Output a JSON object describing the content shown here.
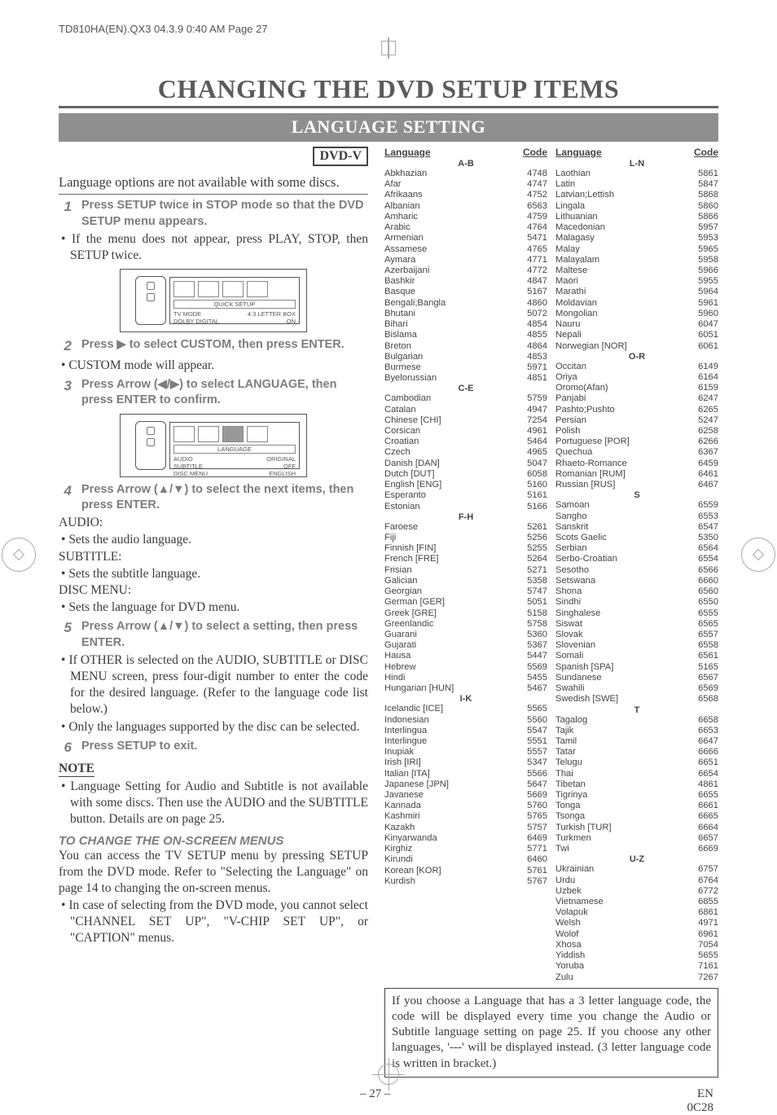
{
  "header": "TD810HA(EN).QX3  04.3.9  0:40 AM  Page 27",
  "title": "CHANGING THE DVD SETUP ITEMS",
  "subtitle": "LANGUAGE SETTING",
  "dvd_badge": "DVD-V",
  "intro": "Language options are not available with some discs.",
  "steps": {
    "s1": {
      "num": "1",
      "text": "Press SETUP twice in STOP mode so that the DVD SETUP menu appears."
    },
    "s1_note": "If the menu does not appear, press PLAY, STOP, then SETUP twice.",
    "diagram1": {
      "bar": "QUICK SETUP",
      "l1a": "TV MODE",
      "l1b": "4:3 LETTER BOX",
      "l2a": "DOLBY DIGITAL",
      "l2b": "ON"
    },
    "s2": {
      "num": "2",
      "text": "Press ▶ to select CUSTOM, then press ENTER."
    },
    "s2_note": "CUSTOM mode will appear.",
    "s3": {
      "num": "3",
      "text": "Press Arrow (◀/▶) to select LANGUAGE, then press ENTER to confirm."
    },
    "diagram2": {
      "bar": "LANGUAGE",
      "l1a": "AUDIO",
      "l1b": "ORIGINAL",
      "l2a": "SUBTITLE",
      "l2b": "OFF",
      "l3a": "DISC MENU",
      "l3b": "ENGLISH"
    },
    "s4": {
      "num": "4",
      "text": "Press Arrow (▲/▼) to select the next items, then press ENTER."
    },
    "audio_label": "AUDIO:",
    "audio_desc": "Sets the audio language.",
    "subtitle_label": "SUBTITLE:",
    "subtitle_desc": "Sets the subtitle language.",
    "disc_label": "DISC MENU:",
    "disc_desc": "Sets the language for DVD menu.",
    "s5": {
      "num": "5",
      "text": "Press Arrow (▲/▼) to select a setting, then press ENTER."
    },
    "s5_n1": "If OTHER is selected on the AUDIO, SUBTITLE or DISC MENU screen, press four-digit number to enter the code for the desired language. (Refer to the language code list below.)",
    "s5_n2": "Only the languages supported by the disc can be selected.",
    "s6": {
      "num": "6",
      "text": "Press SETUP to exit."
    },
    "note_head": "NOTE",
    "note_body": "Language Setting for Audio and Subtitle is not available with some discs. Then use the AUDIO and the SUBTITLE button. Details are on page 25.",
    "menus_head": "TO CHANGE THE ON-SCREEN MENUS",
    "menus_body": "You can access the TV SETUP menu by pressing SETUP from the DVD mode. Refer to \"Selecting the Language\" on page 14 to changing the on-screen menus.",
    "menus_bullet": "In case of selecting from the DVD mode, you cannot select \"CHANNEL SET UP\", \"V-CHIP SET UP\", or \"CAPTION\" menus."
  },
  "table": {
    "h_lang": "Language",
    "h_code": "Code",
    "col1": [
      {
        "type": "section",
        "label": "A-B"
      },
      {
        "name": "Abkhazian",
        "code": "4748"
      },
      {
        "name": "Afar",
        "code": "4747"
      },
      {
        "name": "Afrikaans",
        "code": "4752"
      },
      {
        "name": "Albanian",
        "code": "6563"
      },
      {
        "name": "Amharic",
        "code": "4759"
      },
      {
        "name": "Arabic",
        "code": "4764"
      },
      {
        "name": "Armenian",
        "code": "5471"
      },
      {
        "name": "Assamese",
        "code": "4765"
      },
      {
        "name": "Aymara",
        "code": "4771"
      },
      {
        "name": "Azerbaijani",
        "code": "4772"
      },
      {
        "name": "Bashkir",
        "code": "4847"
      },
      {
        "name": "Basque",
        "code": "5167"
      },
      {
        "name": "Bengali;Bangla",
        "code": "4860"
      },
      {
        "name": "Bhutani",
        "code": "5072"
      },
      {
        "name": "Bihari",
        "code": "4854"
      },
      {
        "name": "Bislama",
        "code": "4855"
      },
      {
        "name": "Breton",
        "code": "4864"
      },
      {
        "name": "Bulgarian",
        "code": "4853"
      },
      {
        "name": "Burmese",
        "code": "5971"
      },
      {
        "name": "Byelorussian",
        "code": "4851"
      },
      {
        "type": "section",
        "label": "C-E"
      },
      {
        "name": "Cambodian",
        "code": "5759"
      },
      {
        "name": "Catalan",
        "code": "4947"
      },
      {
        "name": "Chinese [CHI]",
        "code": "7254"
      },
      {
        "name": "Corsican",
        "code": "4961"
      },
      {
        "name": "Croatian",
        "code": "5464"
      },
      {
        "name": "Czech",
        "code": "4965"
      },
      {
        "name": "Danish [DAN]",
        "code": "5047"
      },
      {
        "name": "Dutch [DUT]",
        "code": "6058"
      },
      {
        "name": "English [ENG]",
        "code": "5160"
      },
      {
        "name": "Esperanto",
        "code": "5161"
      },
      {
        "name": "Estonian",
        "code": "5166"
      },
      {
        "type": "section",
        "label": "F-H"
      },
      {
        "name": "Faroese",
        "code": "5261"
      },
      {
        "name": "Fiji",
        "code": "5256"
      },
      {
        "name": "Finnish [FIN]",
        "code": "5255"
      },
      {
        "name": "French [FRE]",
        "code": "5264"
      },
      {
        "name": "Frisian",
        "code": "5271"
      },
      {
        "name": "Galician",
        "code": "5358"
      },
      {
        "name": "Georgian",
        "code": "5747"
      },
      {
        "name": "German [GER]",
        "code": "5051"
      },
      {
        "name": "Greek [GRE]",
        "code": "5158"
      },
      {
        "name": "Greenlandic",
        "code": "5758"
      },
      {
        "name": "Guarani",
        "code": "5360"
      },
      {
        "name": "Gujarati",
        "code": "5367"
      },
      {
        "name": "Hausa",
        "code": "5447"
      },
      {
        "name": "Hebrew",
        "code": "5569"
      },
      {
        "name": "Hindi",
        "code": "5455"
      },
      {
        "name": "Hungarian [HUN]",
        "code": "5467"
      },
      {
        "type": "section",
        "label": "I-K"
      },
      {
        "name": "Icelandic [ICE]",
        "code": "5565"
      },
      {
        "name": "Indonesian",
        "code": "5560"
      },
      {
        "name": "Interlingua",
        "code": "5547"
      },
      {
        "name": "Interlingue",
        "code": "5551"
      },
      {
        "name": "Inupiak",
        "code": "5557"
      },
      {
        "name": "Irish [IRI]",
        "code": "5347"
      },
      {
        "name": "Italian [ITA]",
        "code": "5566"
      },
      {
        "name": "Japanese [JPN]",
        "code": "5647"
      },
      {
        "name": "Javanese",
        "code": "5669"
      },
      {
        "name": "Kannada",
        "code": "5760"
      },
      {
        "name": "Kashmiri",
        "code": "5765"
      },
      {
        "name": "Kazakh",
        "code": "5757"
      },
      {
        "name": "Kinyarwanda",
        "code": "6469"
      },
      {
        "name": "Kirghiz",
        "code": "5771"
      },
      {
        "name": "Kirundi",
        "code": "6460"
      },
      {
        "name": "Korean [KOR]",
        "code": "5761"
      },
      {
        "name": "Kurdish",
        "code": "5767"
      }
    ],
    "col2": [
      {
        "type": "section",
        "label": "L-N"
      },
      {
        "name": "Laothian",
        "code": "5861"
      },
      {
        "name": "Latin",
        "code": "5847"
      },
      {
        "name": "Latvian;Lettish",
        "code": "5868"
      },
      {
        "name": "Lingala",
        "code": "5860"
      },
      {
        "name": "Lithuanian",
        "code": "5866"
      },
      {
        "name": "Macedonian",
        "code": "5957"
      },
      {
        "name": "Malagasy",
        "code": "5953"
      },
      {
        "name": "Malay",
        "code": "5965"
      },
      {
        "name": "Malayalam",
        "code": "5958"
      },
      {
        "name": "Maltese",
        "code": "5966"
      },
      {
        "name": "Maori",
        "code": "5955"
      },
      {
        "name": "Marathi",
        "code": "5964"
      },
      {
        "name": "Moldavian",
        "code": "5961"
      },
      {
        "name": "Mongolian",
        "code": "5960"
      },
      {
        "name": "Nauru",
        "code": "6047"
      },
      {
        "name": "Nepali",
        "code": "6051"
      },
      {
        "name": "Norwegian [NOR]",
        "code": "6061"
      },
      {
        "type": "section",
        "label": "O-R"
      },
      {
        "name": "Occitan",
        "code": "6149"
      },
      {
        "name": "Oriya",
        "code": "6164"
      },
      {
        "name": "Oromo(Afan)",
        "code": "6159"
      },
      {
        "name": "Panjabi",
        "code": "6247"
      },
      {
        "name": "Pashto;Pushto",
        "code": "6265"
      },
      {
        "name": "Persian",
        "code": "5247"
      },
      {
        "name": "Polish",
        "code": "6258"
      },
      {
        "name": "Portuguese [POR]",
        "code": "6266"
      },
      {
        "name": "Quechua",
        "code": "6367"
      },
      {
        "name": "Rhaeto-Romance",
        "code": "6459"
      },
      {
        "name": "Romanian [RUM]",
        "code": "6461"
      },
      {
        "name": "Russian [RUS]",
        "code": "6467"
      },
      {
        "type": "section",
        "label": "S"
      },
      {
        "name": "Samoan",
        "code": "6559"
      },
      {
        "name": "Sangho",
        "code": "6553"
      },
      {
        "name": "Sanskrit",
        "code": "6547"
      },
      {
        "name": "Scots Gaelic",
        "code": "5350"
      },
      {
        "name": "Serbian",
        "code": "6564"
      },
      {
        "name": "Serbo-Croatian",
        "code": "6554"
      },
      {
        "name": "Sesotho",
        "code": "6566"
      },
      {
        "name": "Setswana",
        "code": "6660"
      },
      {
        "name": "Shona",
        "code": "6560"
      },
      {
        "name": "Sindhi",
        "code": "6550"
      },
      {
        "name": "Singhalese",
        "code": "6555"
      },
      {
        "name": "Siswat",
        "code": "6565"
      },
      {
        "name": "Slovak",
        "code": "6557"
      },
      {
        "name": "Slovenian",
        "code": "6558"
      },
      {
        "name": "Somali",
        "code": "6561"
      },
      {
        "name": "Spanish [SPA]",
        "code": "5165"
      },
      {
        "name": "Sundanese",
        "code": "6567"
      },
      {
        "name": "Swahili",
        "code": "6569"
      },
      {
        "name": "Swedish [SWE]",
        "code": "6568"
      },
      {
        "type": "section",
        "label": "T"
      },
      {
        "name": "Tagalog",
        "code": "6658"
      },
      {
        "name": "Tajik",
        "code": "6653"
      },
      {
        "name": "Tamil",
        "code": "6647"
      },
      {
        "name": "Tatar",
        "code": "6666"
      },
      {
        "name": "Telugu",
        "code": "6651"
      },
      {
        "name": "Thai",
        "code": "6654"
      },
      {
        "name": "Tibetan",
        "code": "4861"
      },
      {
        "name": "Tigrinya",
        "code": "6655"
      },
      {
        "name": "Tonga",
        "code": "6661"
      },
      {
        "name": "Tsonga",
        "code": "6665"
      },
      {
        "name": "Turkish [TUR]",
        "code": "6664"
      },
      {
        "name": "Turkmen",
        "code": "6657"
      },
      {
        "name": "Twi",
        "code": "6669"
      },
      {
        "type": "section",
        "label": "U-Z"
      },
      {
        "name": "Ukrainian",
        "code": "6757"
      },
      {
        "name": "Urdu",
        "code": "6764"
      },
      {
        "name": "Uzbek",
        "code": "6772"
      },
      {
        "name": "Vietnamese",
        "code": "6855"
      },
      {
        "name": "Volapuk",
        "code": "6861"
      },
      {
        "name": "Welsh",
        "code": "4971"
      },
      {
        "name": "Wolof",
        "code": "6961"
      },
      {
        "name": "Xhosa",
        "code": "7054"
      },
      {
        "name": "Yiddish",
        "code": "5655"
      },
      {
        "name": "Yoruba",
        "code": "7161"
      },
      {
        "name": "Zulu",
        "code": "7267"
      }
    ]
  },
  "note_box": "If you choose a Language that has a 3 letter language code, the code will be displayed every time you change the Audio or Subtitle language setting on page 25. If you choose any other languages, '---' will be displayed instead. (3 letter language code is written in bracket.)",
  "footer": {
    "page": "– 27 –",
    "right1": "EN",
    "right2": "0C28"
  }
}
